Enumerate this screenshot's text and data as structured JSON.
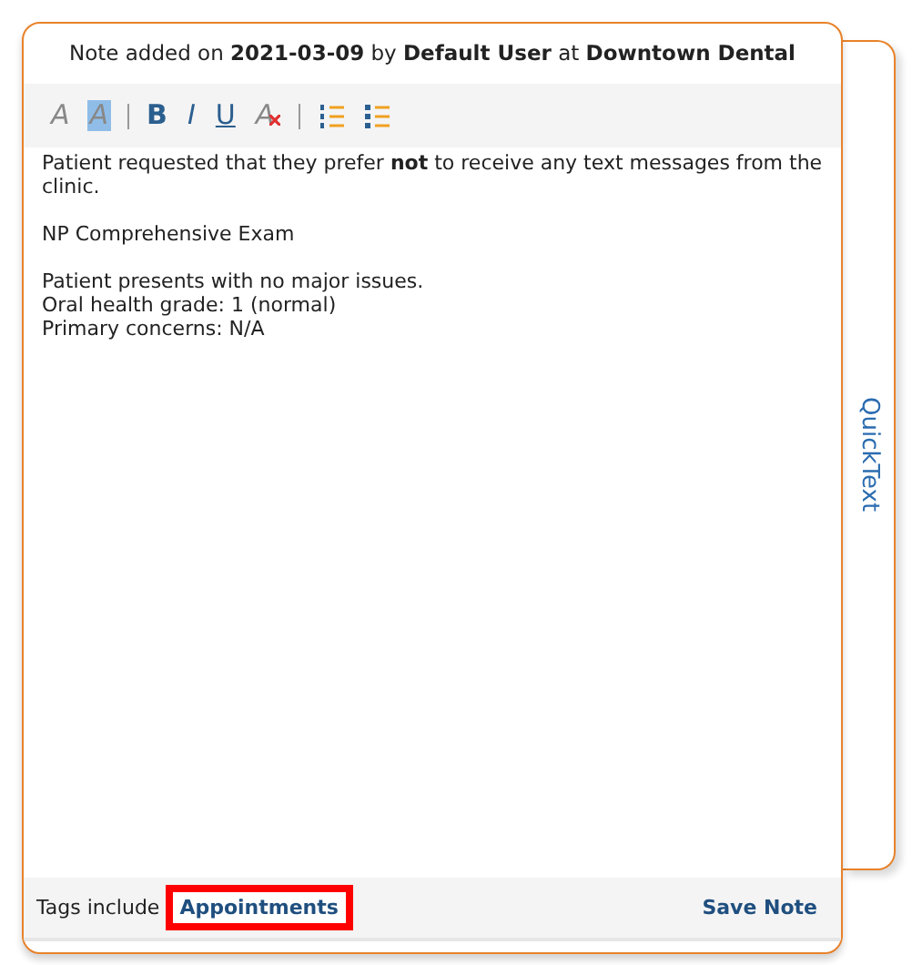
{
  "header": "Note added on **2021-03-09** by **Default User** at **Downtown Dental**",
  "toolbar": [
    {
      "kind": "font",
      "label": "A"
    },
    {
      "kind": "highlight",
      "label": "A"
    },
    {
      "kind": "separator"
    },
    {
      "kind": "bold",
      "label": "B"
    },
    {
      "kind": "italic",
      "label": "I"
    },
    {
      "kind": "underline",
      "label": "U"
    },
    {
      "kind": "clear",
      "label": "A"
    },
    {
      "kind": "separator"
    },
    {
      "kind": "ordered-list"
    },
    {
      "kind": "bullet-list"
    }
  ],
  "body": [
    [
      "Patient requested that they prefer **not** to receive any text messages from the clinic."
    ],
    [
      "NP Comprehensive Exam"
    ],
    [
      "Patient presents with no major issues.",
      "Oral health grade: 1 (normal)",
      "Primary concerns: N/A"
    ]
  ],
  "side_tab": "QuickText",
  "footer": {
    "tags_label": "Tags include",
    "tags": [
      {
        "label": "Appointments",
        "highlighted": true
      }
    ],
    "save": "Save Note"
  }
}
